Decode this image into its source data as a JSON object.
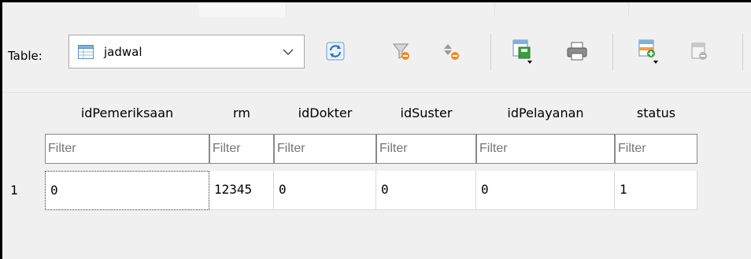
{
  "toolbar": {
    "table_label": "Table:",
    "table_name": "jadwal",
    "buttons": [
      {
        "name": "refresh-icon"
      },
      {
        "name": "clear-filters-icon"
      },
      {
        "name": "clear-sort-icon"
      },
      {
        "name": "save-changes-icon"
      },
      {
        "name": "print-icon"
      },
      {
        "name": "insert-record-icon"
      },
      {
        "name": "delete-record-icon"
      }
    ]
  },
  "grid": {
    "columns": [
      "idPemeriksaan",
      "rm",
      "idDokter",
      "idSuster",
      "idPelayanan",
      "status"
    ],
    "filter_placeholder": "Filter",
    "rows": [
      {
        "num": "1",
        "values": [
          "0",
          "12345",
          "0",
          "0",
          "0",
          "1"
        ]
      }
    ]
  },
  "colors": {
    "toolbar_bg": "#f0f0f0",
    "cell_bg": "#ffffff",
    "filter_text": "#7a7a7a"
  }
}
